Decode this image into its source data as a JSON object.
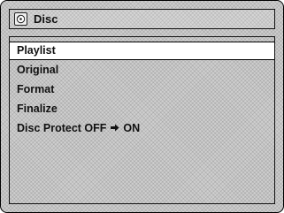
{
  "header": {
    "title": "Disc",
    "icon": "disc-icon"
  },
  "menu": {
    "items": [
      {
        "label": "Playlist",
        "selected": true
      },
      {
        "label": "Original",
        "selected": false
      },
      {
        "label": "Format",
        "selected": false
      },
      {
        "label": "Finalize",
        "selected": false
      },
      {
        "label_before": "Disc Protect OFF",
        "arrow_icon": "right-arrow-icon",
        "label_after": "ON",
        "selected": false
      }
    ]
  }
}
